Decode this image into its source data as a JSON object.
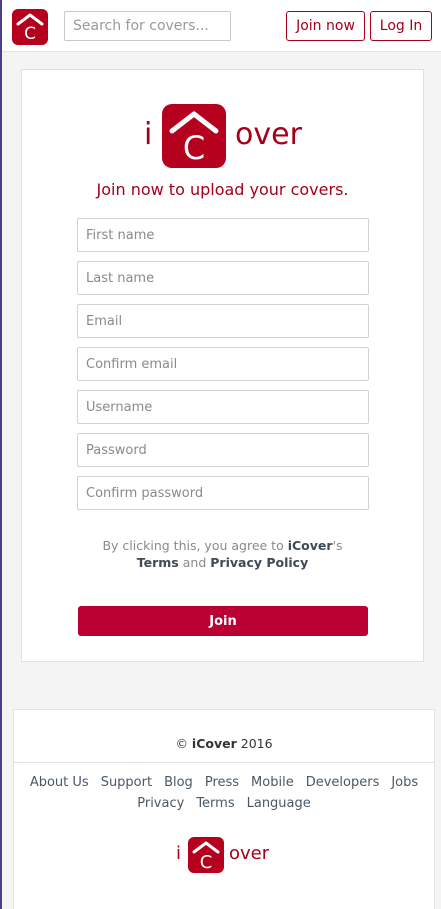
{
  "header": {
    "search_placeholder": "Search for covers...",
    "join_label": "Join now",
    "login_label": "Log In"
  },
  "brand": {
    "letter_i": "i",
    "letter_c": "C",
    "rest": "over"
  },
  "signup": {
    "headline": "Join now to upload your covers.",
    "fields": {
      "first_name": "First name",
      "last_name": "Last name",
      "email": "Email",
      "confirm_email": "Confirm email",
      "username": "Username",
      "password": "Password",
      "confirm_password": "Confirm password"
    },
    "terms_prefix": "By clicking this, you agree to",
    "terms_brand": "iCover",
    "terms_possessive": "'s",
    "terms_link": "Terms",
    "terms_and": "and",
    "privacy_link": "Privacy Policy",
    "join_button": "Join"
  },
  "footer": {
    "copyright_symbol": "©",
    "copyright_brand": "iCover",
    "copyright_year": "2016",
    "links_row1": [
      "About Us",
      "Support",
      "Blog",
      "Press",
      "Mobile",
      "Developers",
      "Jobs"
    ],
    "links_row2": [
      "Privacy",
      "Terms",
      "Language"
    ]
  },
  "colors": {
    "brand": "#b5001e",
    "join_button": "#bb0033",
    "text_link": "#4a5866"
  },
  "icons": {
    "logo": "house-c-logo-icon"
  }
}
